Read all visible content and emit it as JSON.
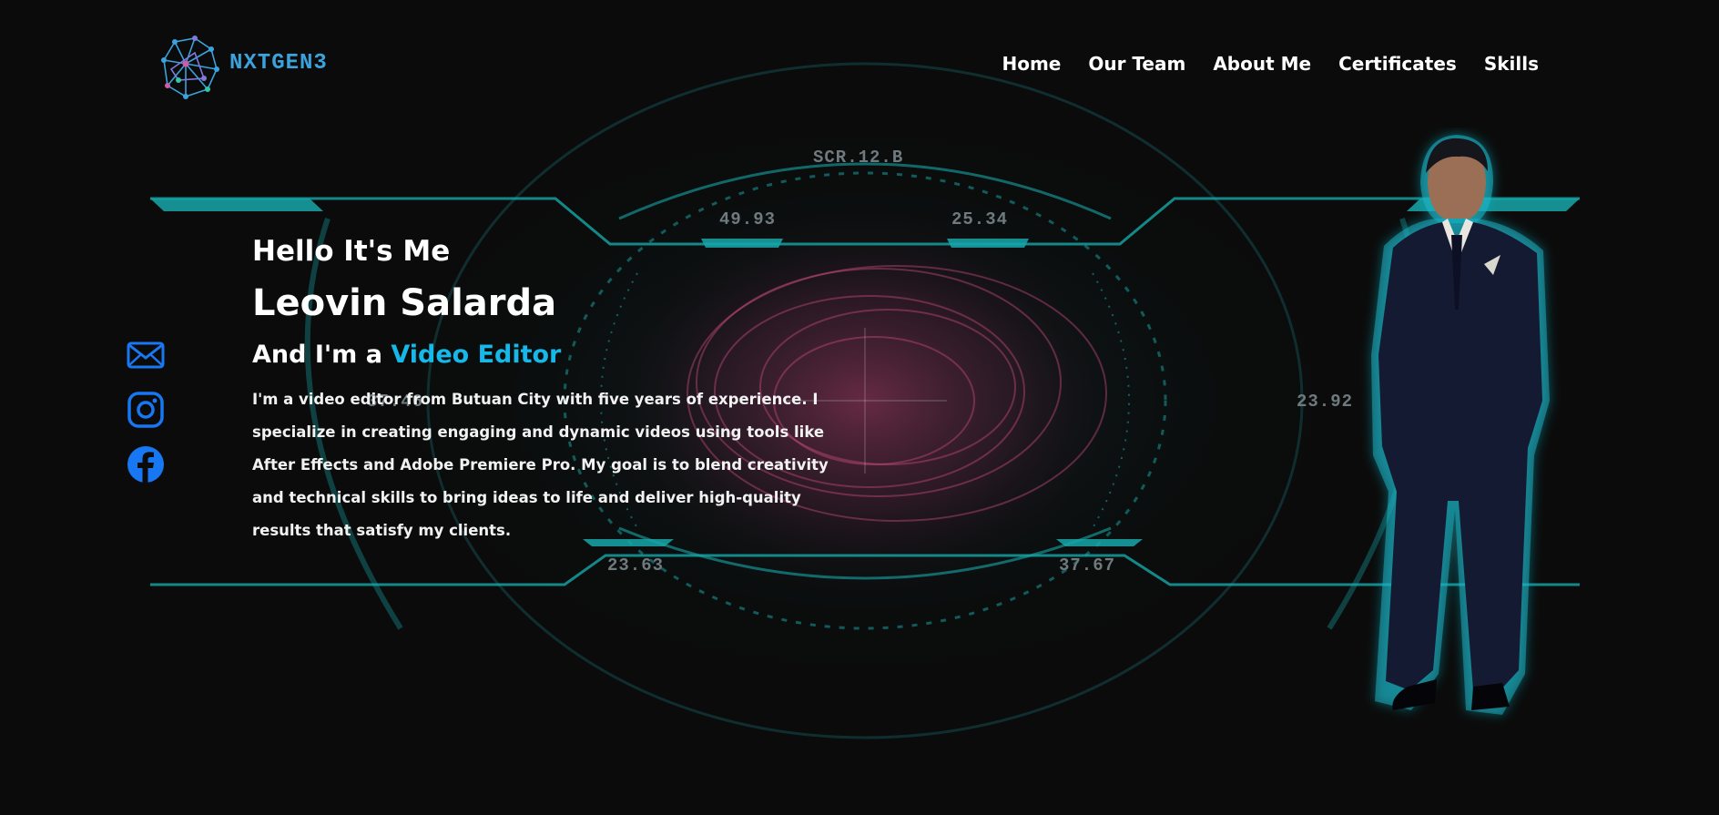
{
  "brand": {
    "name": "NXTGEN3",
    "color": "#3aa2dc"
  },
  "nav": {
    "items": [
      {
        "label": "Home"
      },
      {
        "label": "Our Team"
      },
      {
        "label": "About Me"
      },
      {
        "label": "Certificates"
      },
      {
        "label": "Skills"
      }
    ]
  },
  "hud": {
    "labels": {
      "top": "SCR.12.B",
      "top_left": "49.93",
      "top_right": "25.34",
      "left": "37.46",
      "right": "23.92",
      "bottom_left": "23.63",
      "bottom_right": "37.67"
    }
  },
  "socials": [
    {
      "icon": "mail-icon"
    },
    {
      "icon": "instagram-icon"
    },
    {
      "icon": "facebook-icon"
    }
  ],
  "intro": {
    "greeting": "Hello It's Me",
    "name": "Leovin Salarda",
    "role_prefix": "And I'm a ",
    "role": "Video Editor",
    "bio": "I'm a video editor from Butuan City with five years of experience. I specialize in creating engaging and dynamic videos using tools like After Effects and Adobe Premiere Pro. My goal is to blend creativity and technical skills to bring ideas to life and deliver high-quality results that satisfy my clients."
  },
  "colors": {
    "background": "#0b0b0b",
    "accent": "#15b8e8",
    "hud": "#16a6a8",
    "social": "#1877f2"
  }
}
